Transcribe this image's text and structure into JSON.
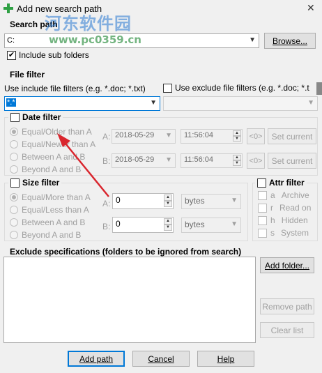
{
  "window": {
    "title": "Add new search path",
    "close_glyph": "✕",
    "plus_icon": "plus-icon"
  },
  "watermark": {
    "line1": "河东软件园",
    "line2": "www.pc0359.cn"
  },
  "search_path": {
    "label": "Search path",
    "value": "C:",
    "browse_label": "Browse...",
    "include_sub_label": "Include sub folders",
    "include_sub_checked": true
  },
  "file_filter": {
    "heading": "File filter",
    "include_label": "Use include file filters (e.g. *.doc; *.txt)",
    "exclude_label": "Use exclude file filters (e.g. *.doc; *.t",
    "include_value": "*.*",
    "exclude_value": ""
  },
  "date_filter": {
    "label": "Date filter",
    "options": [
      "Equal/Older than A",
      "Equal/Newer than A",
      "Between A and B",
      "Beyond A and B"
    ],
    "a_label": "A:",
    "b_label": "B:",
    "a_date": "2018-05-29",
    "a_time": "11:56:04",
    "b_date": "2018-05-29",
    "b_time": "11:56:04",
    "zero_label": "<0>",
    "set_current_label": "Set current"
  },
  "size_filter": {
    "label": "Size filter",
    "options": [
      "Equal/More than A",
      "Equal/Less than A",
      "Between A and B",
      "Beyond A and B"
    ],
    "a_label": "A:",
    "b_label": "B:",
    "a_value": "0",
    "b_value": "0",
    "a_unit": "bytes",
    "b_unit": "bytes"
  },
  "attr_filter": {
    "label": "Attr filter",
    "items": [
      {
        "key": "a",
        "name": "Archive"
      },
      {
        "key": "r",
        "name": "Read on"
      },
      {
        "key": "h",
        "name": "Hidden"
      },
      {
        "key": "s",
        "name": "System"
      }
    ]
  },
  "exclude": {
    "heading": "Exclude specifications (folders to be ignored from search)",
    "add_folder_label": "Add folder...",
    "remove_path_label": "Remove path",
    "clear_list_label": "Clear list"
  },
  "footer": {
    "add_path_label": "Add path",
    "cancel_label": "Cancel",
    "help_label": "Help"
  },
  "colors": {
    "accent": "#0078d7",
    "arrow": "#d9262e"
  }
}
